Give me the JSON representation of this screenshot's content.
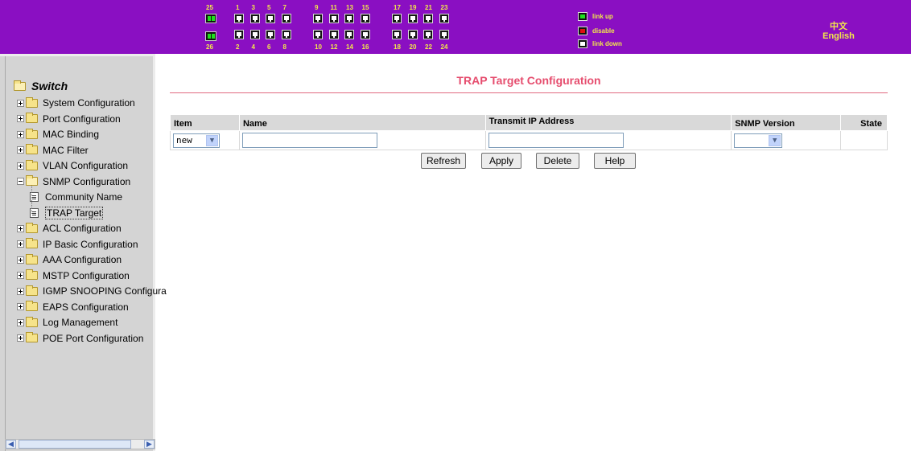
{
  "banner": {
    "colors": {
      "background": "#8a0fc2",
      "text": "#f2e84a"
    },
    "port_top_numbers": [
      "1",
      "3",
      "5",
      "7",
      "9",
      "11",
      "13",
      "15",
      "17",
      "19",
      "21",
      "23"
    ],
    "port_bottom_numbers": [
      "2",
      "4",
      "6",
      "8",
      "10",
      "12",
      "14",
      "16",
      "18",
      "20",
      "22",
      "24"
    ],
    "combo_top": "25",
    "combo_bottom": "26",
    "legend": [
      {
        "icon": "port-link-up-icon",
        "label": "link up"
      },
      {
        "icon": "port-disable-icon",
        "label": "disable"
      },
      {
        "icon": "port-link-down-icon",
        "label": "link down"
      }
    ],
    "lang_chinese": "中文",
    "lang_english": "English"
  },
  "sidebar": {
    "root": "Switch",
    "items": [
      {
        "label": "System Configuration",
        "icon": "folder-icon"
      },
      {
        "label": "Port Configuration",
        "icon": "folder-icon"
      },
      {
        "label": "MAC Binding",
        "icon": "folder-icon"
      },
      {
        "label": "MAC Filter",
        "icon": "folder-icon"
      },
      {
        "label": "VLAN Configuration",
        "icon": "folder-icon"
      },
      {
        "label": "SNMP Configuration",
        "icon": "folder-open-icon",
        "expanded": true
      },
      {
        "label": "Community Name",
        "icon": "document-icon"
      },
      {
        "label": "TRAP Target",
        "icon": "document-icon",
        "selected": true
      },
      {
        "label": "ACL Configuration",
        "icon": "folder-icon"
      },
      {
        "label": "IP Basic Configuration",
        "icon": "folder-icon"
      },
      {
        "label": "AAA Configuration",
        "icon": "folder-icon"
      },
      {
        "label": "MSTP Configuration",
        "icon": "folder-icon"
      },
      {
        "label": "IGMP SNOOPING Configura",
        "icon": "folder-icon"
      },
      {
        "label": "EAPS Configuration",
        "icon": "folder-icon"
      },
      {
        "label": "Log Management",
        "icon": "folder-icon"
      },
      {
        "label": "POE Port Configuration",
        "icon": "folder-icon"
      }
    ]
  },
  "main": {
    "title": "TRAP Target Configuration",
    "title_color": "#e64d6e",
    "table": {
      "headers": [
        "Item",
        "Name",
        "Transmit IP Address",
        "SNMP Version",
        "State"
      ],
      "row": {
        "item": "new",
        "name": "",
        "ip": "",
        "snmp_version": "",
        "state": ""
      }
    },
    "buttons": {
      "refresh": "Refresh",
      "apply": "Apply",
      "delete": "Delete",
      "help": "Help"
    }
  }
}
